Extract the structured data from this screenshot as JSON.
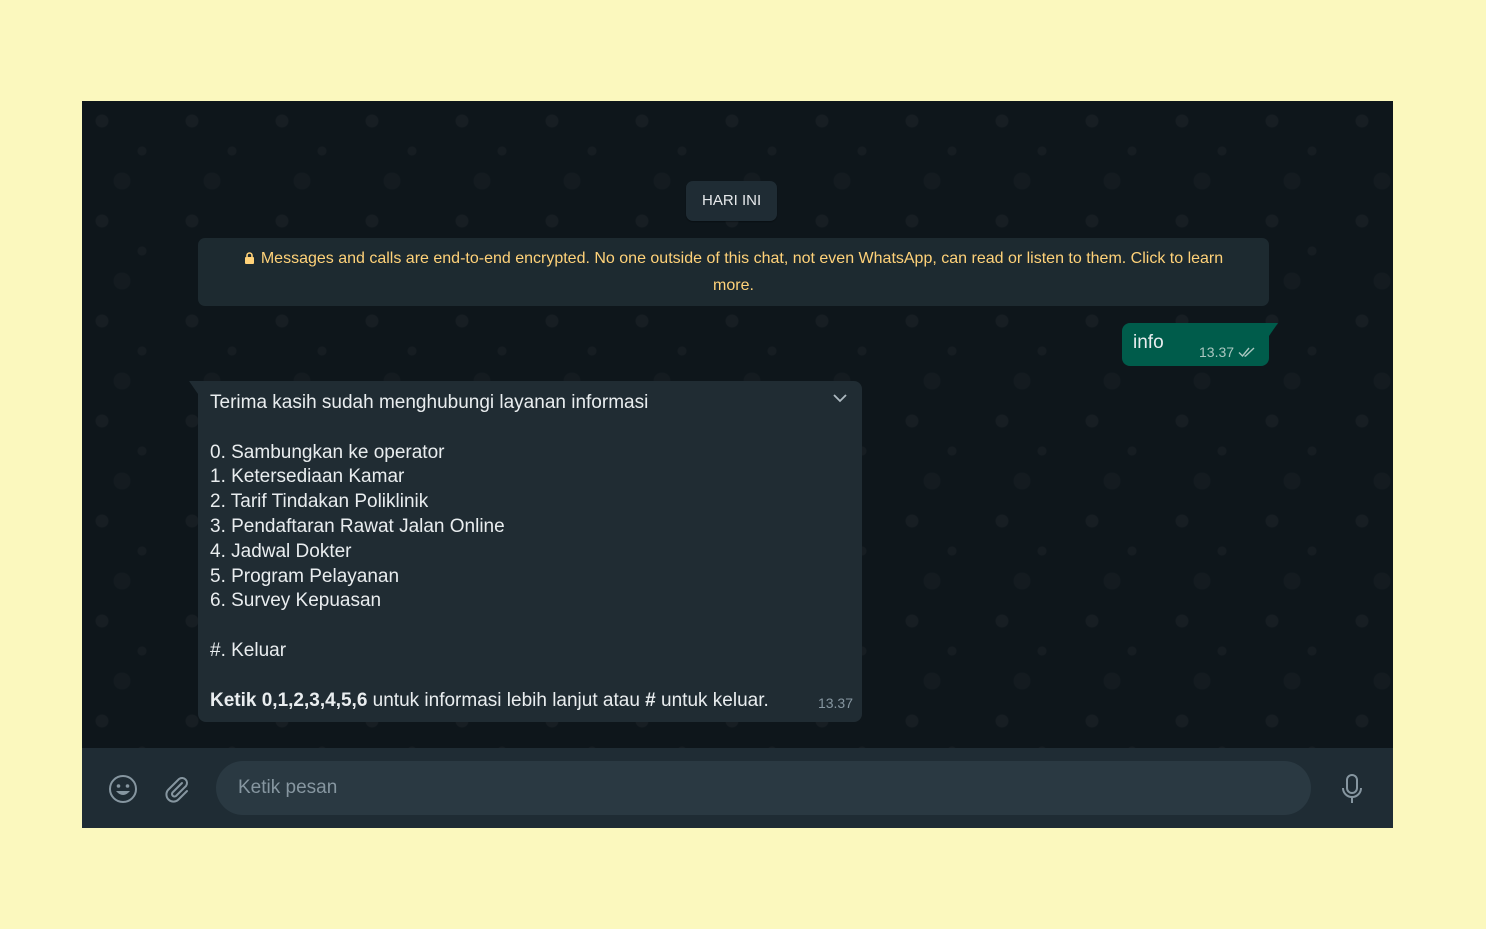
{
  "chat": {
    "date_chip": "HARI INI",
    "encryption_notice": "Messages and calls are end-to-end encrypted. No one outside of this chat, not even WhatsApp, can read or listen to them. Click to learn more.",
    "outgoing": {
      "text": "info",
      "time": "13.37"
    },
    "incoming": {
      "greeting": "Terima kasih sudah menghubungi layanan informasi",
      "options": [
        "0. Sambungkan ke operator",
        "1. Ketersediaan Kamar",
        "2. Tarif Tindakan Poliklinik",
        "3. Pendaftaran Rawat Jalan Online",
        "4. Jadwal Dokter",
        "5. Program Pelayanan",
        "6. Survey Kepuasan"
      ],
      "exit": "#. Keluar",
      "instruction_bold_1": "Ketik 0,1,2,3,4,5,6",
      "instruction_mid": " untuk informasi lebih lanjut atau ",
      "instruction_bold_2": "#",
      "instruction_end": " untuk keluar.",
      "time": "13.37"
    }
  },
  "composer": {
    "placeholder": "Ketik pesan"
  },
  "colors": {
    "accent_outgoing": "#005c4b",
    "notice_text": "#ffd279",
    "page_bg": "#fbf8be"
  }
}
